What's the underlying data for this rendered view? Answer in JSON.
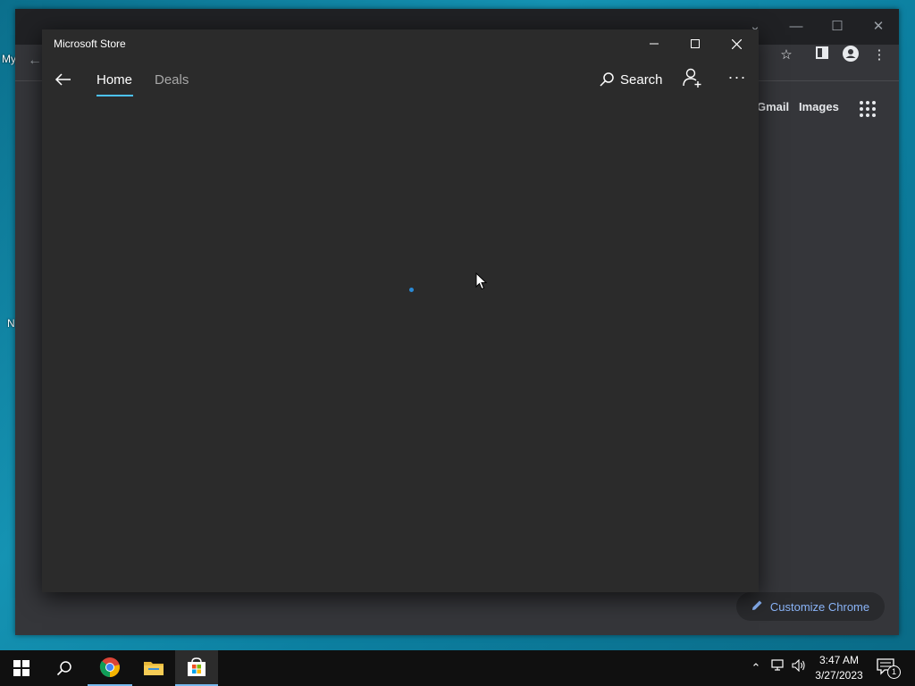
{
  "desktop": {
    "labels": [
      "My",
      "N"
    ]
  },
  "chrome": {
    "links": {
      "gmail": "Gmail",
      "images": "Images"
    },
    "customize_label": "Customize Chrome"
  },
  "store": {
    "title": "Microsoft Store",
    "tabs": [
      {
        "label": "Home",
        "selected": true
      },
      {
        "label": "Deals",
        "selected": false
      }
    ],
    "search_label": "Search",
    "loading": true,
    "accent": "#4cc2ff"
  },
  "taskbar": {
    "apps": [
      "start-icon",
      "search-icon",
      "chrome-icon",
      "file-explorer-icon",
      "microsoft-store-icon"
    ],
    "clock": {
      "time": "3:47 AM",
      "date": "3/27/2023"
    },
    "notification_count": "1"
  }
}
